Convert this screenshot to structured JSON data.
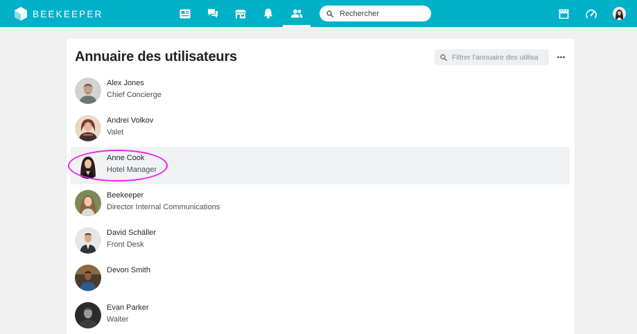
{
  "app": {
    "brand": "BEEKEEPER"
  },
  "topbar": {
    "search_placeholder": "Rechercher",
    "nav": [
      {
        "icon": "news-icon",
        "label": ""
      },
      {
        "icon": "chat-icon",
        "label": ""
      },
      {
        "icon": "shop-icon",
        "label": ""
      },
      {
        "icon": "bell-icon",
        "label": ""
      },
      {
        "icon": "users-icon",
        "label": "",
        "active": true
      }
    ],
    "right": [
      {
        "icon": "kiosk-icon"
      },
      {
        "icon": "dashboard-gauge-icon"
      },
      {
        "icon": "profile-avatar"
      }
    ]
  },
  "directory": {
    "title": "Annuaire des utilisateurs",
    "filter_placeholder": "Filtrer l'annuaire des utilisa",
    "more_icon": "more-horizontal-icon",
    "users": [
      {
        "name": "Alex Jones",
        "role": "Chief Concierge"
      },
      {
        "name": "Andrei Volkov",
        "role": "Valet"
      },
      {
        "name": "Anne Cook",
        "role": "Hotel Manager",
        "highlighted": true
      },
      {
        "name": "Beekeeper",
        "role": "Director Internal Communications"
      },
      {
        "name": "David Schäller",
        "role": "Front Desk"
      },
      {
        "name": "Devon Smith",
        "role": ""
      },
      {
        "name": "Evan Parker",
        "role": "Waiter"
      }
    ]
  },
  "colors": {
    "topbar": "#00b1c9",
    "page_bg": "#f0f0f0",
    "highlight_row": "#f1f2f3",
    "annotation": "#f01ef0"
  }
}
